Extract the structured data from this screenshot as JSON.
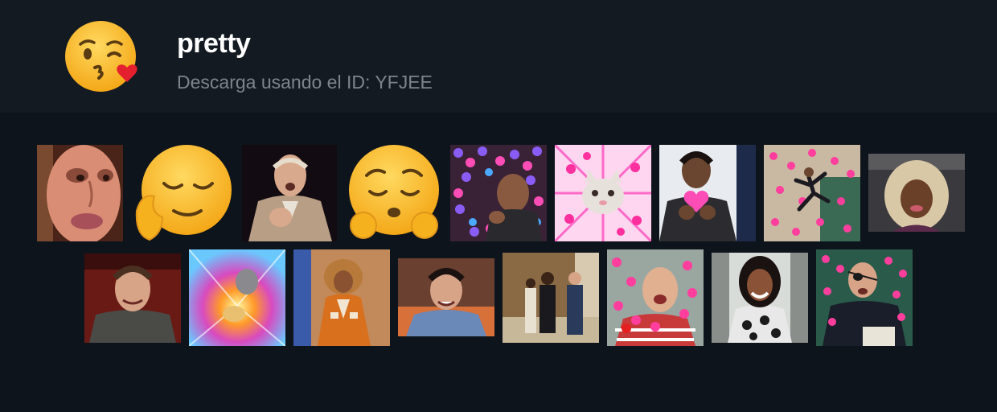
{
  "pack": {
    "title": "pretty",
    "subtitle": "Descarga usando el ID: YFJEE",
    "icon": "kissing-face-with-heart-emoji"
  },
  "colors": {
    "page_background": "#0e141b",
    "header_background": "#131a21",
    "title": "#ffffff",
    "subtitle": "#7d858c"
  },
  "stickers": [
    {
      "icon": "man-closeup-face"
    },
    {
      "icon": "relieved-face-hand-on-cheek-emoji"
    },
    {
      "icon": "man-gasping-hand-on-chest"
    },
    {
      "icon": "pleading-face-hands-emoji"
    },
    {
      "icon": "man-pointing-hearts"
    },
    {
      "icon": "cat-hearts-burst"
    },
    {
      "icon": "man-holding-heart"
    },
    {
      "icon": "dancer-hearts"
    },
    {
      "icon": "woman-blonde-curly-hair"
    },
    {
      "icon": "man-smiling"
    },
    {
      "icon": "colorful-burst-hands"
    },
    {
      "icon": "woman-dancing-curly-hair"
    },
    {
      "icon": "man-surprised-smile"
    },
    {
      "icon": "people-walking-hallway"
    },
    {
      "icon": "man-crying-hearts"
    },
    {
      "icon": "woman-laughing"
    },
    {
      "icon": "man-eyepatch-hearts"
    }
  ]
}
